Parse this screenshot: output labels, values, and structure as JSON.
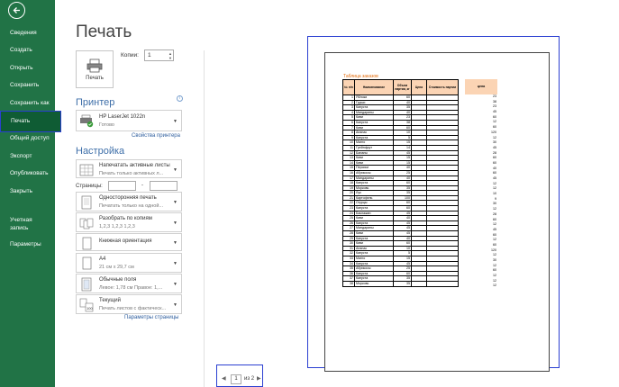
{
  "sidebar": {
    "items": [
      {
        "label": "Сведения"
      },
      {
        "label": "Создать"
      },
      {
        "label": "Открыть"
      },
      {
        "label": "Сохранить"
      },
      {
        "label": "Сохранить как"
      },
      {
        "label": "Печать"
      },
      {
        "label": "Общий доступ"
      },
      {
        "label": "Экспорт"
      },
      {
        "label": "Опубликовать"
      },
      {
        "label": "Закрыть"
      },
      {
        "label": "Учетная запись"
      },
      {
        "label": "Параметры"
      }
    ],
    "accent": "#217346"
  },
  "main": {
    "title": "Печать",
    "print_button": "Печать",
    "copies_label": "Копии:",
    "copies_value": "1",
    "printer_heading": "Принтер",
    "printer_name": "HP LaserJet 1022n",
    "printer_status": "Готово",
    "printer_props": "Свойства принтера",
    "settings_heading": "Настройка",
    "settings": [
      {
        "title": "Напечатать активные листы",
        "sub": "Печать только активных л..."
      },
      {
        "title": "Односторонняя печать",
        "sub": "Печатать только на одной..."
      },
      {
        "title": "Разобрать по копиям",
        "sub": "1,2,3    1,2,3    1,2,3"
      },
      {
        "title": "Книжная ориентация",
        "sub": ""
      },
      {
        "title": "A4",
        "sub": "21 см x 29,7 см"
      },
      {
        "title": "Обычные поля",
        "sub": "Левое: 1,78 см    Правое: 1,..."
      },
      {
        "title": "Текущий",
        "sub": "Печать листов с фактическ..."
      }
    ],
    "pages_label": "Страницы:",
    "page_setup_link": "Параметры страницы"
  },
  "preview": {
    "sheet_title": "Таблица заказов",
    "headers": [
      "№ п/п",
      "Наименование",
      "Объем партии, кг",
      "Цена",
      "Стоимость партии"
    ],
    "price_header": "цена",
    "rows": [
      [
        "1",
        "Яблоки",
        "60",
        "23"
      ],
      [
        "2",
        "Груши",
        "40",
        "38"
      ],
      [
        "3",
        "Капуста",
        "35",
        "23"
      ],
      [
        "4",
        "Мандарины",
        "40",
        "45"
      ],
      [
        "5",
        "Киви",
        "23",
        "60"
      ],
      [
        "6",
        "Капуста",
        "38",
        "12"
      ],
      [
        "7",
        "Киви",
        "60",
        "60"
      ],
      [
        "8",
        "Ананас",
        "10",
        "120"
      ],
      [
        "9",
        "Капуста",
        "5",
        "12"
      ],
      [
        "10",
        "Манго",
        "15",
        "30"
      ],
      [
        "11",
        "Грейпфрут",
        "14",
        "45"
      ],
      [
        "12",
        "Бананы",
        "45",
        "28"
      ],
      [
        "13",
        "Киви",
        "15",
        "60"
      ],
      [
        "14",
        "Киви",
        "15",
        "60"
      ],
      [
        "15",
        "Персики",
        "40",
        "40"
      ],
      [
        "16",
        "Абрикосы",
        "25",
        "60"
      ],
      [
        "17",
        "Мандарины",
        "40",
        "45"
      ],
      [
        "18",
        "Капуста",
        "60",
        "12"
      ],
      [
        "19",
        "Морковь",
        "35",
        "12"
      ],
      [
        "20",
        "Лук",
        "35",
        "10"
      ],
      [
        "21",
        "Картофель",
        "100",
        "9"
      ],
      [
        "22",
        "Огурцы",
        "60",
        "30"
      ],
      [
        "23",
        "Капуста",
        "60",
        "12"
      ],
      [
        "24",
        "Баклажан",
        "45",
        "28"
      ],
      [
        "25",
        "Киви",
        "40",
        "60"
      ],
      [
        "26",
        "Капуста",
        "45",
        "12"
      ],
      [
        "27",
        "Мандарины",
        "45",
        "45"
      ],
      [
        "28",
        "Киви",
        "45",
        "60"
      ],
      [
        "29",
        "Капуста",
        "40",
        "12"
      ],
      [
        "30",
        "Киви",
        "60",
        "60"
      ],
      [
        "31",
        "Ананас",
        "10",
        "120"
      ],
      [
        "32",
        "Капуста",
        "5",
        "12"
      ],
      [
        "33",
        "Манго",
        "15",
        "30"
      ],
      [
        "34",
        "Капуста",
        "45",
        "12"
      ],
      [
        "35",
        "Абрикосы",
        "25",
        "60"
      ],
      [
        "36",
        "Капуста",
        "60",
        "12"
      ],
      [
        "37",
        "Капуста",
        "35",
        "12"
      ],
      [
        "38",
        "Морковь",
        "35",
        "12"
      ]
    ],
    "page_current": "1",
    "page_total": "из 2"
  }
}
